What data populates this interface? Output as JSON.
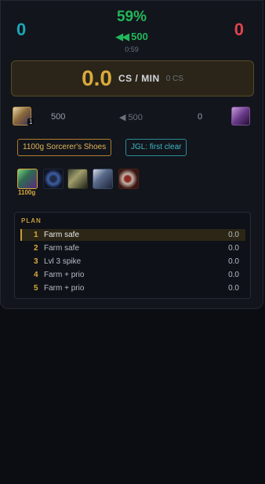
{
  "header": {
    "score_left": "0",
    "score_right": "0",
    "win_percent": "59%",
    "gold_diff_arrows": "◀◀",
    "gold_diff": "500",
    "game_time": "0:59",
    "colors": {
      "blue_team": "#1aa7b8",
      "red_team": "#e0434d",
      "positive": "#22b75a"
    }
  },
  "cs": {
    "value": "0.0",
    "unit": "CS / MIN",
    "count": "0 CS",
    "accent": "#d9a93c"
  },
  "matchup": {
    "left_champion_icon": "ally-champion-portrait",
    "left_level": "1",
    "left_gold": "500",
    "diff_arrow": "◀",
    "diff_gold": "500",
    "right_gold": "0",
    "right_champion_icon": "enemy-champion-portrait"
  },
  "tags": {
    "item_goal": "1100g Sorcerer's Shoes",
    "jungle_note": "JGL: first clear"
  },
  "items": {
    "icons": [
      "sorcerers-shoes-icon",
      "dark-seal-icon",
      "shield-emblem-icon",
      "blade-item-icon",
      "serpent-item-icon"
    ],
    "first_cost": "1100g"
  },
  "plan": {
    "title": "PLAN",
    "rows": [
      {
        "num": "1",
        "label": "Farm safe",
        "value": "0.0",
        "active": true
      },
      {
        "num": "2",
        "label": "Farm safe",
        "value": "0.0",
        "active": false
      },
      {
        "num": "3",
        "label": "Lvl 3 spike",
        "value": "0.0",
        "active": false
      },
      {
        "num": "4",
        "label": "Farm + prio",
        "value": "0.0",
        "active": false
      },
      {
        "num": "5",
        "label": "Farm + prio",
        "value": "0.0",
        "active": false
      }
    ]
  }
}
